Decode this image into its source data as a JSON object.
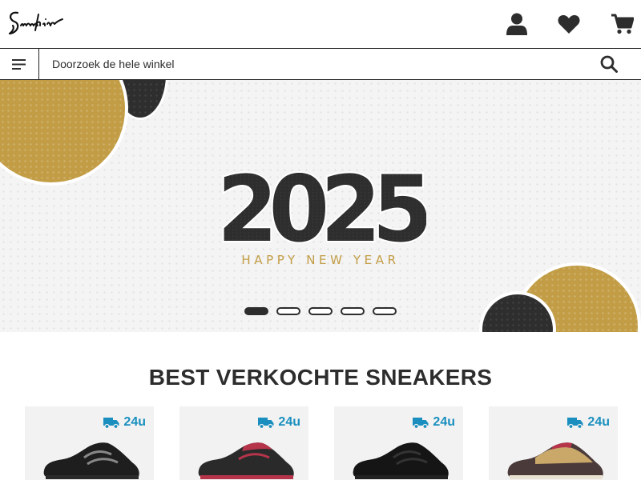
{
  "header": {
    "logo_text": "Sneakin",
    "icons": [
      "user-icon",
      "heart-icon",
      "cart-icon"
    ]
  },
  "search": {
    "placeholder": "Doorzoek de hele winkel",
    "value": ""
  },
  "hero": {
    "year": "2025",
    "subtitle": "HAPPY NEW YEAR",
    "slides_count": 5,
    "active_slide": 1
  },
  "best_sellers": {
    "title": "BEST VERKOCHTE SNEAKERS",
    "products": [
      {
        "delivery": "24u",
        "accent": "#888888"
      },
      {
        "delivery": "24u",
        "accent": "#b5344a"
      },
      {
        "delivery": "24u",
        "accent": "#333333"
      },
      {
        "delivery": "24u",
        "accent": "#c9a86a"
      }
    ]
  },
  "colors": {
    "gold": "#c29d45",
    "dark": "#2e2e2e",
    "delivery_blue": "#1a8fbf"
  }
}
